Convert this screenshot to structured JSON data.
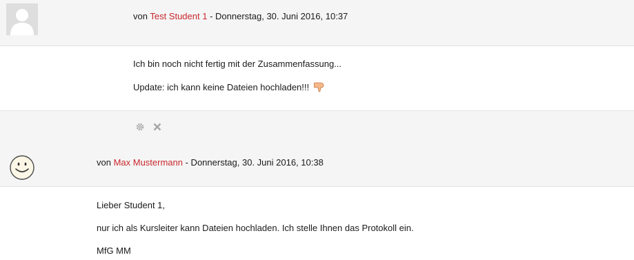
{
  "posts": [
    {
      "by_prefix": "von ",
      "author": "Test Student 1",
      "date": " - Donnerstag, 30. Juni 2016, 10:37",
      "lines": [
        "Ich bin noch nicht fertig mit der Zusammenfassung...",
        "Update: ich kann keine Dateien hochladen!!!"
      ],
      "emoticon": "thumbs-down-icon"
    },
    {
      "by_prefix": "von ",
      "author": "Max Mustermann",
      "date": " - Donnerstag, 30. Juni 2016, 10:38",
      "lines": [
        "Lieber Student 1,",
        "nur ich als Kursleiter kann Dateien hochladen. Ich stelle Ihnen das Protokoll ein.",
        "MfG MM"
      ]
    }
  ],
  "tools": [
    "gear-icon",
    "close-icon"
  ],
  "colors": {
    "author_link": "#c9282d",
    "header_bg": "#f5f5f5",
    "border": "#e3e3e3",
    "tool_icon": "#a6a6a6"
  }
}
